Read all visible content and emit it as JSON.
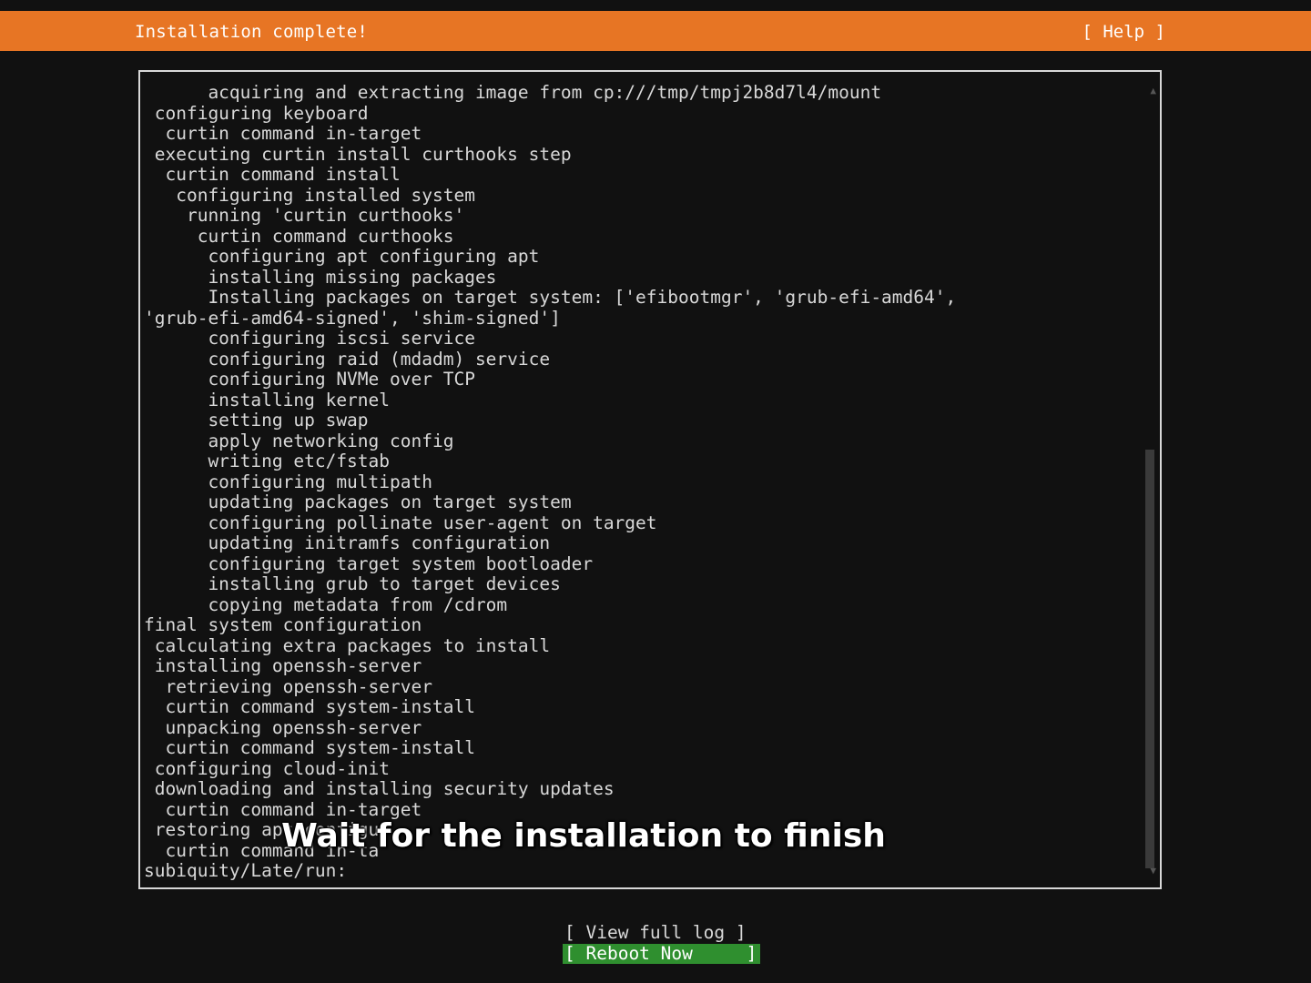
{
  "header": {
    "title": "Installation complete!",
    "help_label": "[ Help ]",
    "accent_color": "#e77524"
  },
  "log": {
    "lines": [
      "      acquiring and extracting image from cp:///tmp/tmpj2b8d7l4/mount",
      " configuring keyboard",
      "  curtin command in-target",
      " executing curtin install curthooks step",
      "  curtin command install",
      "   configuring installed system",
      "    running 'curtin curthooks'",
      "     curtin command curthooks",
      "      configuring apt configuring apt",
      "      installing missing packages",
      "      Installing packages on target system: ['efibootmgr', 'grub-efi-amd64',",
      "'grub-efi-amd64-signed', 'shim-signed']",
      "      configuring iscsi service",
      "      configuring raid (mdadm) service",
      "      configuring NVMe over TCP",
      "      installing kernel",
      "      setting up swap",
      "      apply networking config",
      "      writing etc/fstab",
      "      configuring multipath",
      "      updating packages on target system",
      "      configuring pollinate user-agent on target",
      "      updating initramfs configuration",
      "      configuring target system bootloader",
      "      installing grub to target devices",
      "      copying metadata from /cdrom",
      "final system configuration",
      " calculating extra packages to install",
      " installing openssh-server",
      "  retrieving openssh-server",
      "  curtin command system-install",
      "  unpacking openssh-server",
      "  curtin command system-install",
      " configuring cloud-init",
      " downloading and installing security updates",
      "  curtin command in-target",
      " restoring apt configu",
      "  curtin command in-ta",
      "subiquity/Late/run:"
    ]
  },
  "caption": {
    "text": "Wait for the installation to finish"
  },
  "buttons": {
    "view_log_label": "[ View full log ]",
    "reboot_label": "[ Reboot Now     ]",
    "reboot_highlight_color": "#2f8f2f"
  },
  "icons": {
    "scroll_up": "scroll-up-arrow-icon",
    "scroll_down": "scroll-down-arrow-icon"
  }
}
